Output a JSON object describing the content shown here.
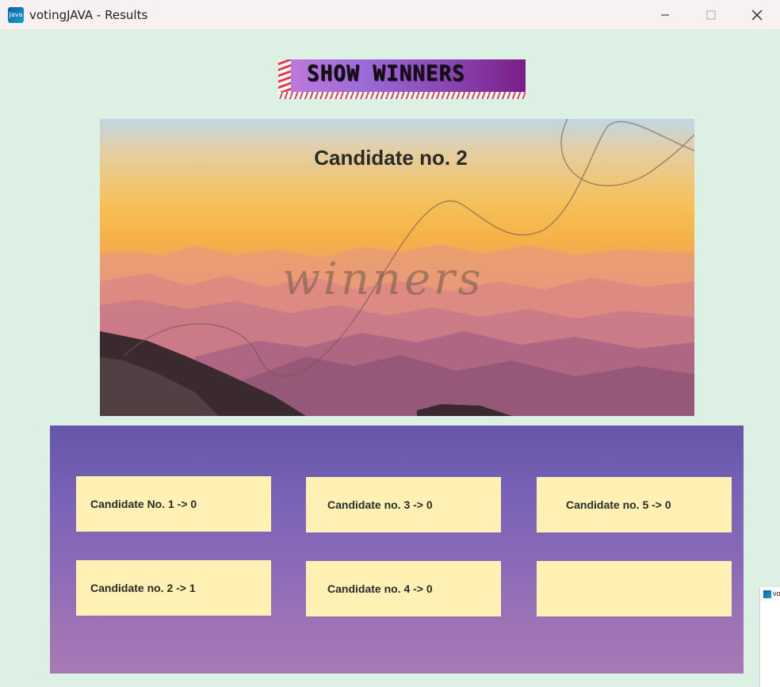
{
  "window": {
    "title": "votingJAVA - Results",
    "icon_text": "Java"
  },
  "banner": {
    "label": "SHOW WINNERS"
  },
  "winner": {
    "name": "Candidate no. 2",
    "image_caption": "winners"
  },
  "results": [
    {
      "label": "Candidate No. 1 -> 0"
    },
    {
      "label": "Candidate no. 3 -> 0"
    },
    {
      "label": "Candidate no. 5 -> 0"
    },
    {
      "label": "Candidate no. 2 -> 1"
    },
    {
      "label": "Candidate no. 4 -> 0"
    },
    {
      "label": ""
    }
  ],
  "peek_window": {
    "text": "voti"
  },
  "colors": {
    "background": "#dcf1e4",
    "card": "#fff0b3",
    "banner_stripe": "#e63a4a"
  }
}
